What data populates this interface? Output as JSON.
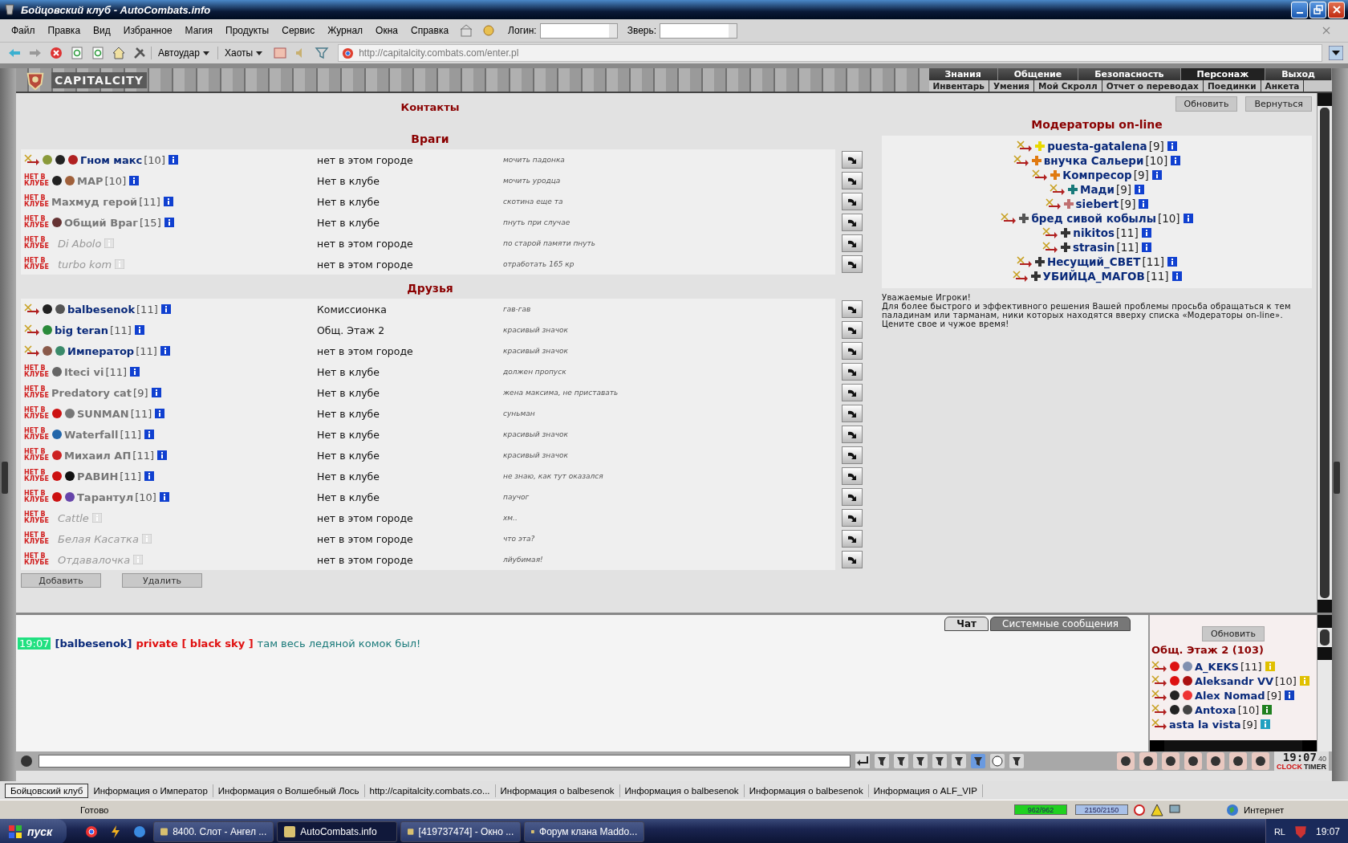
{
  "window": {
    "title": "Бойцовский клуб - AutoCombats.info"
  },
  "menu": [
    "Файл",
    "Правка",
    "Вид",
    "Избранное",
    "Магия",
    "Продукты",
    "Сервис",
    "Журнал",
    "Окна",
    "Справка"
  ],
  "login": {
    "label": "Логин:"
  },
  "pet": {
    "label": "Зверь:"
  },
  "toolbar": {
    "autohit": "Автоудар",
    "chaos": "Хаоты",
    "url": "http://capitalcity.combats.com/enter.pl"
  },
  "game": {
    "logo": "CAPITALCITY",
    "nav": [
      {
        "label": "Знания",
        "selected": false
      },
      {
        "label": "Общение",
        "selected": false
      },
      {
        "label": "Безопасность",
        "selected": false
      },
      {
        "label": "Персонаж",
        "selected": true
      },
      {
        "label": "Выход",
        "selected": false
      }
    ],
    "subnav": [
      "Инвентарь",
      "Умения",
      "Мой Скролл",
      "Отчет о переводах",
      "Поединки",
      "Анкета"
    ]
  },
  "contacts": {
    "title": "Контакты",
    "buttons": [
      "Обновить",
      "Вернуться"
    ],
    "sections": [
      {
        "title": "Враги",
        "rows": [
          {
            "kind": "online",
            "name": "Гном макс",
            "rank": "[10]",
            "location": "нет в этом городе",
            "note": "мочить падонка",
            "signs": [
              {
                "color": "#8a9a3a"
              },
              {
                "color": "#222222"
              },
              {
                "color": "#b02020"
              }
            ]
          },
          {
            "kind": "offline",
            "badge": "НЕТ В КЛУБЕ",
            "name": "МАР",
            "rank": "[10]",
            "location": "Нет в клубе",
            "note": "мочить уродца",
            "signs": [
              {
                "color": "#222222"
              },
              {
                "color": "#a0603a"
              }
            ]
          },
          {
            "kind": "offline",
            "badge": "НЕТ В КЛУБЕ",
            "name": "Махмуд герой",
            "rank": "[11]",
            "location": "Нет в клубе",
            "note": "скотина еще та",
            "signs": []
          },
          {
            "kind": "offline",
            "badge": "НЕТ В КЛУБЕ",
            "name": "Общий Враг",
            "rank": "[15]",
            "location": "Нет в клубе",
            "note": "пнуть при случае",
            "signs": [
              {
                "color": "#663333"
              }
            ]
          },
          {
            "kind": "away",
            "badge": "НЕТ В КЛУБЕ",
            "name": "Di Abolo",
            "location": "нет в этом городе",
            "note": "по старой памяти пнуть",
            "signs": []
          },
          {
            "kind": "away",
            "badge": "НЕТ В КЛУБЕ",
            "name": "turbo kom",
            "location": "нет в этом городе",
            "note": "отработать 165 кр",
            "signs": []
          }
        ]
      },
      {
        "title": "Друзья",
        "rows": [
          {
            "kind": "online",
            "name": "balbesenok",
            "rank": "[11]",
            "location": "Комиссионка",
            "note": "гав-гав",
            "signs": [
              {
                "color": "#222222"
              },
              {
                "color": "#555555"
              }
            ]
          },
          {
            "kind": "online",
            "name": "big teran",
            "rank": "[11]",
            "location": "Общ. Этаж 2",
            "note": "красивый значок",
            "signs": [
              {
                "color": "#2a8a3a"
              }
            ]
          },
          {
            "kind": "online",
            "name": "Император",
            "rank": "[11]",
            "location": "нет в этом городе",
            "note": "красивый значок",
            "signs": [
              {
                "color": "#8a5a4a"
              },
              {
                "color": "#3a8a6a"
              }
            ]
          },
          {
            "kind": "offline",
            "badge": "НЕТ В КЛУБЕ",
            "name": "Iteci vi",
            "rank": "[11]",
            "location": "Нет в клубе",
            "note": "должен пропуск",
            "signs": [
              {
                "color": "#666666"
              }
            ]
          },
          {
            "kind": "offline",
            "badge": "НЕТ В КЛУБЕ",
            "name": "Predatory cat",
            "rank": "[9]",
            "location": "Нет в клубе",
            "note": "жена максима, не приставать",
            "signs": []
          },
          {
            "kind": "offline",
            "badge": "НЕТ В КЛУБЕ",
            "name": "SUNMAN",
            "rank": "[11]",
            "location": "Нет в клубе",
            "note": "суньман",
            "signs": [
              {
                "color": "#cc1111"
              },
              {
                "color": "#777777"
              }
            ]
          },
          {
            "kind": "offline",
            "badge": "НЕТ В КЛУБЕ",
            "name": "Waterfall",
            "rank": "[11]",
            "location": "Нет в клубе",
            "note": "красивый значок",
            "signs": [
              {
                "color": "#2266aa"
              }
            ]
          },
          {
            "kind": "offline",
            "badge": "НЕТ В КЛУБЕ",
            "name": "Михаил АП",
            "rank": "[11]",
            "location": "Нет в клубе",
            "note": "красивый значок",
            "signs": [
              {
                "color": "#cc2222"
              }
            ]
          },
          {
            "kind": "offline",
            "badge": "НЕТ В КЛУБЕ",
            "name": "РАВИН",
            "rank": "[11]",
            "location": "Нет в клубе",
            "note": "не знаю, как тут оказался",
            "signs": [
              {
                "color": "#cc1111"
              },
              {
                "color": "#111111"
              }
            ]
          },
          {
            "kind": "offline",
            "badge": "НЕТ В КЛУБЕ",
            "name": "Тарантул",
            "rank": "[10]",
            "location": "Нет в клубе",
            "note": "паучог",
            "signs": [
              {
                "color": "#cc1111"
              },
              {
                "color": "#6644aa"
              }
            ]
          },
          {
            "kind": "away",
            "badge": "НЕТ В КЛУБЕ",
            "name": "Cattle",
            "location": "нет в этом городе",
            "note": "хм..",
            "signs": []
          },
          {
            "kind": "away",
            "badge": "НЕТ В КЛУБЕ",
            "name": "Белая Касатка",
            "location": "нет в этом городе",
            "note": "что эта?",
            "signs": []
          },
          {
            "kind": "away",
            "badge": "НЕТ В КЛУБЕ",
            "name": "Отдавалочка",
            "location": "нет в этом городе",
            "note": "лйубимая!",
            "signs": []
          }
        ]
      }
    ],
    "actions": [
      "Добавить",
      "Удалить"
    ]
  },
  "moderators": {
    "title": "Модераторы on-line",
    "rows": [
      {
        "name": "puesta-gatalena",
        "rank": "[9]",
        "color": "#e8d800"
      },
      {
        "name": "внучка Сальери",
        "rank": "[10]",
        "color": "#e07a10"
      },
      {
        "name": "Компресор",
        "rank": "[9]",
        "color": "#e07a10"
      },
      {
        "name": "Мади",
        "rank": "[9]",
        "color": "#1a7a7a"
      },
      {
        "name": "siebert",
        "rank": "[9]",
        "color": "#c07070"
      },
      {
        "name": "бред сивой кобылы",
        "rank": "[10]",
        "color": "#555555"
      },
      {
        "name": "nikitos",
        "rank": "[11]",
        "color": "#333333"
      },
      {
        "name": "strasin",
        "rank": "[11]",
        "color": "#333333"
      },
      {
        "name": "Несущий_СВЕТ",
        "rank": "[11]",
        "color": "#333333"
      },
      {
        "name": "УБИЙЦА_МАГОВ",
        "rank": "[11]",
        "color": "#333333"
      }
    ],
    "notice": [
      "Уважаемые Игроки!",
      "Для более быстрого и эффективного решения Вашей проблемы просьба обращаться к тем паладинам или тарманам, ники которых находятся вверху списка «Модераторы on-line».",
      "Цените свое и чужое время!"
    ]
  },
  "chat": {
    "tabs": [
      {
        "label": "Чат",
        "selected": true
      },
      {
        "label": "Системные сообщения",
        "selected": false
      }
    ],
    "messages": [
      {
        "time": "19:07",
        "from": "[balbesenok]",
        "to": "private [ black sky ]",
        "text": "там весь ледяной комок был!"
      }
    ]
  },
  "online": {
    "button": "Обновить",
    "title": "Общ. Этаж 2 (103)",
    "rows": [
      {
        "name": "A_KEKS",
        "rank": "[11]",
        "info": {
          "color": "#e0c000"
        },
        "signs": [
          {
            "color": "#dd1111"
          },
          {
            "color": "#8090b0"
          }
        ]
      },
      {
        "name": "Aleksandr VV",
        "rank": "[10]",
        "info": {
          "color": "#e0c000"
        },
        "signs": [
          {
            "color": "#dd1111"
          },
          {
            "color": "#aa1010"
          }
        ]
      },
      {
        "name": "Alex Nomad",
        "rank": "[9]",
        "info": {
          "color": "#1040c0"
        },
        "signs": [
          {
            "color": "#222222"
          },
          {
            "color": "#ee3333"
          }
        ]
      },
      {
        "name": "Antoxa",
        "rank": "[10]",
        "info": {
          "color": "#208020"
        },
        "signs": [
          {
            "color": "#222222"
          },
          {
            "color": "#444444"
          }
        ]
      },
      {
        "name": "asta la vista",
        "rank": "[9]",
        "info": {
          "color": "#20a0c0"
        },
        "signs": []
      }
    ]
  },
  "clock": {
    "time": "19:07",
    "seconds": "40",
    "labels": [
      "CLOCK",
      "TIMER"
    ]
  },
  "window_tabs": [
    {
      "label": "Бойцовский клуб",
      "selected": true
    },
    {
      "label": "Информация о Император",
      "selected": false
    },
    {
      "label": "Информация о Волшебный Лось",
      "selected": false
    },
    {
      "label": "http://capitalcity.combats.co...",
      "selected": false
    },
    {
      "label": "Информация о balbesenok",
      "selected": false
    },
    {
      "label": "Информация о balbesenok",
      "selected": false
    },
    {
      "label": "Информация о balbesenok",
      "selected": false
    },
    {
      "label": "Информация о ALF_VIP",
      "selected": false
    }
  ],
  "status_bar": {
    "text": "Готово",
    "hp": {
      "reading": "962/962",
      "level": 1
    },
    "mana": {
      "reading": "2150/2150",
      "level": 1
    },
    "zone": "Интернет"
  },
  "taskbar": {
    "start": "пуск",
    "items": [
      {
        "label": "8400. Слот - Ангел ...",
        "selected": false
      },
      {
        "label": "AutoCombats.info",
        "selected": true
      },
      {
        "label": "[419737474] - Окно ...",
        "selected": false
      },
      {
        "label": "Форум клана Maddo...",
        "selected": false
      }
    ],
    "lang": "RL",
    "time": "19:07"
  }
}
